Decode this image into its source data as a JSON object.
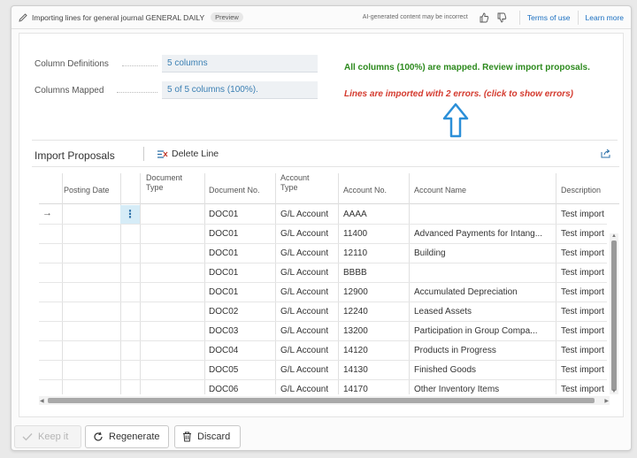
{
  "titlebar": {
    "title": "Importing lines for general journal GENERAL DAILY",
    "badge": "Preview",
    "ai_note": "AI-generated content may be incorrect",
    "terms_link": "Terms of use",
    "learn_link": "Learn more"
  },
  "fields": {
    "column_definitions_label": "Column Definitions",
    "column_definitions_value": "5 columns",
    "columns_mapped_label": "Columns Mapped",
    "columns_mapped_value": "5 of 5 columns (100%)."
  },
  "messages": {
    "mapped": "All columns (100%) are mapped. Review import proposals.",
    "errors": "Lines are imported with 2 errors. (click to show errors)"
  },
  "proposals": {
    "title": "Import Proposals",
    "delete_line": "Delete Line"
  },
  "columns": {
    "posting_date": "Posting Date",
    "document_type_1": "Document",
    "document_type_2": "Type",
    "document_no": "Document No.",
    "account_type_1": "Account",
    "account_type_2": "Type",
    "account_no": "Account No.",
    "account_name": "Account Name",
    "description": "Description"
  },
  "rows": [
    {
      "doc": "DOC01",
      "acct_type": "G/L Account",
      "acct_no": "AAAA",
      "acct_name": "",
      "desc": "Test import"
    },
    {
      "doc": "DOC01",
      "acct_type": "G/L Account",
      "acct_no": "11400",
      "acct_name": "Advanced Payments for Intang...",
      "desc": "Test import"
    },
    {
      "doc": "DOC01",
      "acct_type": "G/L Account",
      "acct_no": "12110",
      "acct_name": "Building",
      "desc": "Test import"
    },
    {
      "doc": "DOC01",
      "acct_type": "G/L Account",
      "acct_no": "BBBB",
      "acct_name": "",
      "desc": "Test import"
    },
    {
      "doc": "DOC01",
      "acct_type": "G/L Account",
      "acct_no": "12900",
      "acct_name": "Accumulated Depreciation",
      "desc": "Test import"
    },
    {
      "doc": "DOC02",
      "acct_type": "G/L Account",
      "acct_no": "12240",
      "acct_name": "Leased Assets",
      "desc": "Test import"
    },
    {
      "doc": "DOC03",
      "acct_type": "G/L Account",
      "acct_no": "13200",
      "acct_name": "Participation in Group Compa...",
      "desc": "Test import"
    },
    {
      "doc": "DOC04",
      "acct_type": "G/L Account",
      "acct_no": "14120",
      "acct_name": "Products in Progress",
      "desc": "Test import"
    },
    {
      "doc": "DOC05",
      "acct_type": "G/L Account",
      "acct_no": "14130",
      "acct_name": "Finished Goods",
      "desc": "Test import"
    },
    {
      "doc": "DOC06",
      "acct_type": "G/L Account",
      "acct_no": "14170",
      "acct_name": "Other Inventory Items",
      "desc": "Test import"
    }
  ],
  "footer": {
    "keep_it": "Keep it",
    "regenerate": "Regenerate",
    "discard": "Discard"
  },
  "colors": {
    "accent": "#1a6fc0",
    "success": "#2d8a1e",
    "error": "#d43a2e"
  }
}
